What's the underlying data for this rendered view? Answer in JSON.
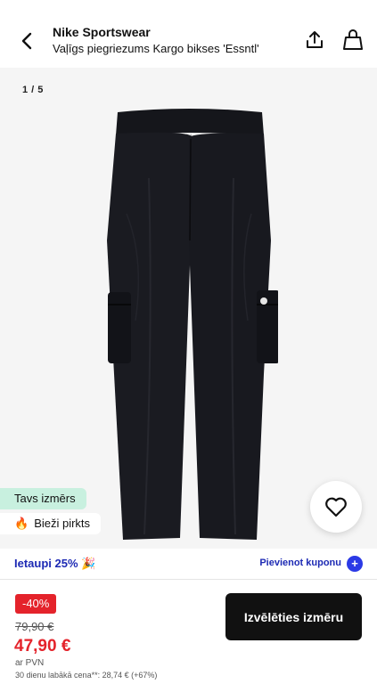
{
  "header": {
    "brand": "Nike Sportswear",
    "subtitle": "Vaļīgs piegriezums Kargo bikses 'Essntl'",
    "back_icon": "chevron-left-icon",
    "share_icon": "share-icon",
    "bag_icon": "shopping-bag-icon"
  },
  "gallery": {
    "counter": "1 / 5",
    "image_name": "black-cargo-pants"
  },
  "badges": {
    "size": "Tavs izmērs",
    "popular_icon": "fire-icon",
    "popular": "Bieži pirkts"
  },
  "wishlist": {
    "icon": "heart-icon"
  },
  "coupon": {
    "text": "Ietaupi 25% 🎉",
    "link": "Pievienot kuponu",
    "plus": "+"
  },
  "price": {
    "discount": "-40%",
    "old": "79,90 €",
    "new": "47,90 €",
    "vat": "ar PVN",
    "lowest": "30 dienu labākā cena**: 28,74 € (+67%)"
  },
  "cta": {
    "label": "Izvēlēties izmēru"
  },
  "colors": {
    "accent": "#1d2ab4",
    "sale": "#e4232b",
    "size_badge": "#c8f0df"
  }
}
